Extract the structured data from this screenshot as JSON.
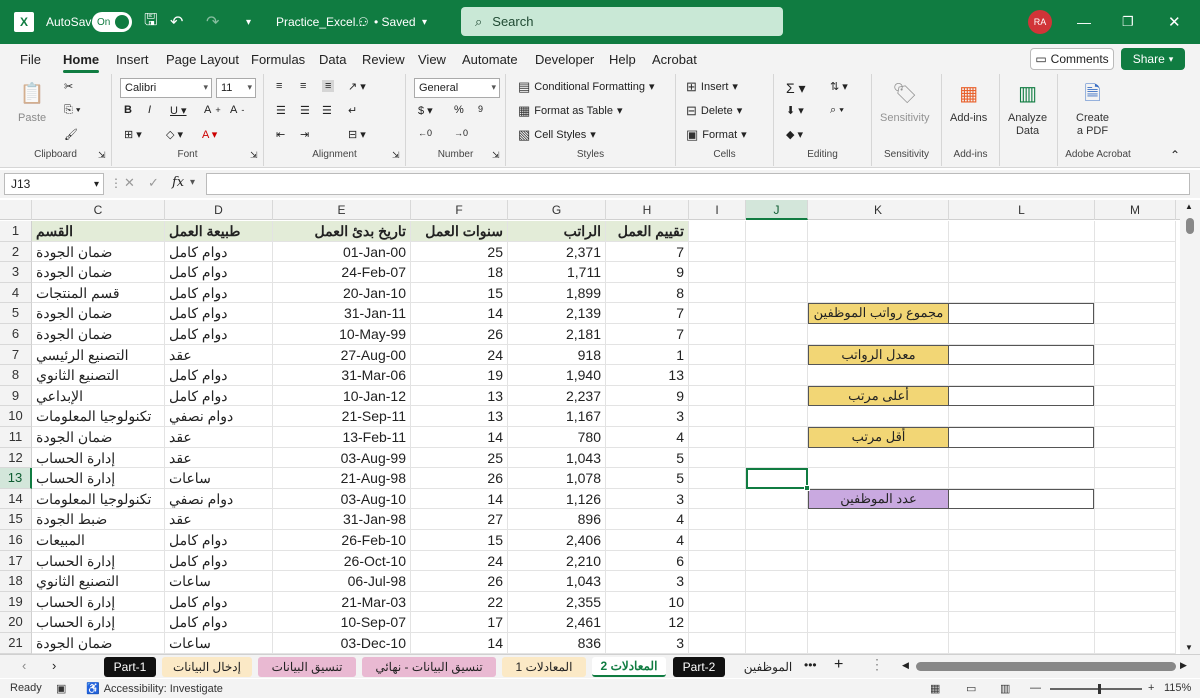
{
  "title_bar": {
    "autosave_label": "AutoSave",
    "autosave_state": "On",
    "file_name": "Practice_Excel...",
    "saved_label": "• Saved",
    "search_placeholder": "Search",
    "user_initials": "RA"
  },
  "menu_tabs": [
    "File",
    "Home",
    "Insert",
    "Page Layout",
    "Formulas",
    "Data",
    "Review",
    "View",
    "Automate",
    "Developer",
    "Help",
    "Acrobat"
  ],
  "comments_label": "Comments",
  "share_label": "Share",
  "ribbon": {
    "clipboard": {
      "label": "Clipboard",
      "paste": "Paste"
    },
    "font": {
      "label": "Font",
      "name": "Calibri",
      "size": "11"
    },
    "alignment": {
      "label": "Alignment"
    },
    "number": {
      "label": "Number",
      "format": "General"
    },
    "styles": {
      "label": "Styles",
      "conditional": "Conditional Formatting",
      "format_table": "Format as Table",
      "cell_styles": "Cell Styles"
    },
    "cells": {
      "label": "Cells",
      "insert": "Insert",
      "delete": "Delete",
      "format": "Format"
    },
    "editing": {
      "label": "Editing"
    },
    "sensitivity": {
      "label": "Sensitivity",
      "button": "Sensitivity"
    },
    "addins": {
      "label": "Add-ins",
      "button": "Add-ins"
    },
    "analyze": {
      "line1": "Analyze",
      "line2": "Data"
    },
    "acrobat": {
      "label": "Adobe Acrobat",
      "line1": "Create",
      "line2": "a PDF"
    }
  },
  "formula_bar": {
    "name_box": "J13",
    "fx": "fx",
    "content": ""
  },
  "columns": [
    "C",
    "D",
    "E",
    "F",
    "G",
    "H",
    "I",
    "J",
    "K",
    "L",
    "M"
  ],
  "rows": [
    "1",
    "2",
    "3",
    "4",
    "5",
    "6",
    "7",
    "8",
    "9",
    "10",
    "11",
    "12",
    "13",
    "14",
    "15",
    "16",
    "17",
    "18",
    "19",
    "20",
    "21"
  ],
  "table_headers": [
    "القسم",
    "طبيعة العمل",
    "تاريخ بدئ العمل",
    "سنوات العمل",
    "الراتب",
    "تقييم العمل"
  ],
  "table_rows": [
    [
      "ضمان الجودة",
      "دوام كامل",
      "01-Jan-00",
      "25",
      "2,371",
      "7"
    ],
    [
      "ضمان الجودة",
      "دوام كامل",
      "24-Feb-07",
      "18",
      "1,711",
      "9"
    ],
    [
      "قسم المنتجات",
      "دوام كامل",
      "20-Jan-10",
      "15",
      "1,899",
      "8"
    ],
    [
      "ضمان الجودة",
      "دوام كامل",
      "31-Jan-11",
      "14",
      "2,139",
      "7"
    ],
    [
      "ضمان الجودة",
      "دوام كامل",
      "10-May-99",
      "26",
      "2,181",
      "7"
    ],
    [
      "التصنيع الرئيسي",
      "عقد",
      "27-Aug-00",
      "24",
      "918",
      "1"
    ],
    [
      "التصنيع الثانوي",
      "دوام كامل",
      "31-Mar-06",
      "19",
      "1,940",
      "13"
    ],
    [
      "الإبداعي",
      "دوام كامل",
      "10-Jan-12",
      "13",
      "2,237",
      "9"
    ],
    [
      "تكنولوجيا المعلومات",
      "دوام نصفي",
      "21-Sep-11",
      "13",
      "1,167",
      "3"
    ],
    [
      "ضمان الجودة",
      "عقد",
      "13-Feb-11",
      "14",
      "780",
      "4"
    ],
    [
      "إدارة الحساب",
      "عقد",
      "03-Aug-99",
      "25",
      "1,043",
      "5"
    ],
    [
      "إدارة الحساب",
      "ساعات",
      "21-Aug-98",
      "26",
      "1,078",
      "5"
    ],
    [
      "تكنولوجيا المعلومات",
      "دوام نصفي",
      "03-Aug-10",
      "14",
      "1,126",
      "3"
    ],
    [
      "ضبط الجودة",
      "عقد",
      "31-Jan-98",
      "27",
      "896",
      "4"
    ],
    [
      "المبيعات",
      "دوام كامل",
      "26-Feb-10",
      "15",
      "2,406",
      "4"
    ],
    [
      "إدارة الحساب",
      "دوام كامل",
      "26-Oct-10",
      "24",
      "2,210",
      "6"
    ],
    [
      "التصنيع الثانوي",
      "ساعات",
      "06-Jul-98",
      "26",
      "1,043",
      "3"
    ],
    [
      "إدارة الحساب",
      "دوام كامل",
      "21-Mar-03",
      "22",
      "2,355",
      "10"
    ],
    [
      "إدارة الحساب",
      "دوام كامل",
      "10-Sep-07",
      "17",
      "2,461",
      "12"
    ],
    [
      "ضمان الجودة",
      "ساعات",
      "03-Dec-10",
      "14",
      "836",
      "3"
    ]
  ],
  "summary": [
    {
      "label": "مجموع رواتب الموظفين",
      "color": "#f2d675"
    },
    {
      "label": "معدل الرواتب",
      "color": "#f2d675"
    },
    {
      "label": "أعلى مرتب",
      "color": "#f2d675"
    },
    {
      "label": "أقل مرتب",
      "color": "#f2d675"
    },
    {
      "label": "عدد الموظفين",
      "color": "#c9a9e0"
    }
  ],
  "sheet_tabs": [
    {
      "label": "Part-1",
      "bg": "#111111",
      "fg": "#ffffff"
    },
    {
      "label": "إدخال البيانات",
      "bg": "#fbe9c6",
      "fg": "#222222"
    },
    {
      "label": "تنسيق البيانات",
      "bg": "#e9b9d2",
      "fg": "#222222"
    },
    {
      "label": "تنسيق البيانات - نهائي",
      "bg": "#e9b9d2",
      "fg": "#222222"
    },
    {
      "label": "المعادلات 1",
      "bg": "#fbe9c6",
      "fg": "#222222"
    },
    {
      "label": "المعادلات 2",
      "bg": "#ffffff",
      "fg": "#107c41"
    },
    {
      "label": "Part-2",
      "bg": "#111111",
      "fg": "#ffffff"
    },
    {
      "label": "الموظفين",
      "bg": "#f3f3f3",
      "fg": "#222222"
    }
  ],
  "status": {
    "ready": "Ready",
    "accessibility": "Accessibility: Investigate",
    "zoom": "115%"
  }
}
